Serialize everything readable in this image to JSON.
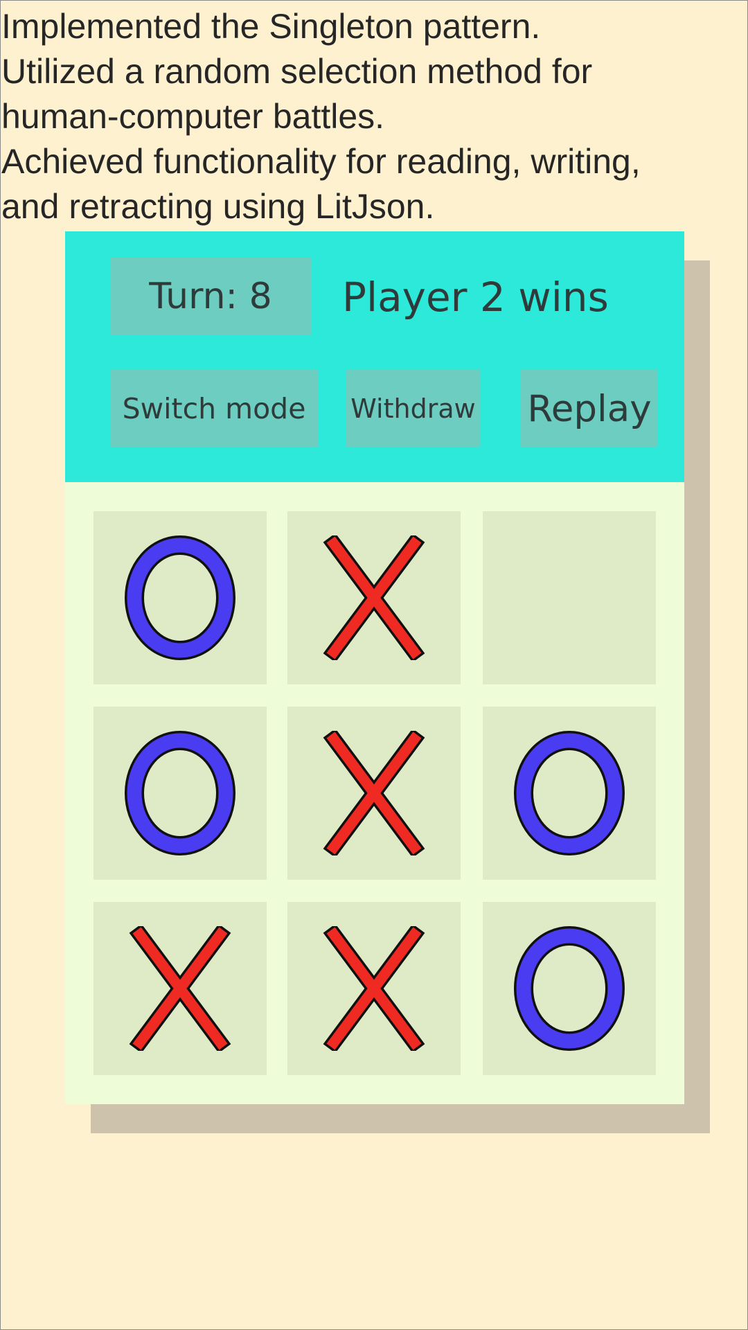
{
  "notes": [
    "Implemented the Singleton pattern.",
    "Utilized a random selection method for",
    "human-computer battles.",
    "Achieved functionality for reading, writing,",
    "and retracting using LitJson."
  ],
  "game": {
    "turn_label": "Turn: 8",
    "status": "Player 2 wins",
    "buttons": {
      "switch_mode": "Switch mode",
      "withdraw": "Withdraw",
      "replay": "Replay"
    },
    "board": [
      [
        "O",
        "X",
        ""
      ],
      [
        "O",
        "X",
        "O"
      ],
      [
        "X",
        "X",
        "O"
      ]
    ]
  },
  "colors": {
    "background": "#fdf1cf",
    "header": "#2ce9d9",
    "button": "#6ccdc0",
    "board_background": "#eefcd7",
    "cell": "#dfeac7",
    "o_mark": "#4a3cf0",
    "x_mark": "#ef2a23"
  },
  "icons": {
    "O": "circle-o-icon",
    "X": "cross-x-icon"
  }
}
